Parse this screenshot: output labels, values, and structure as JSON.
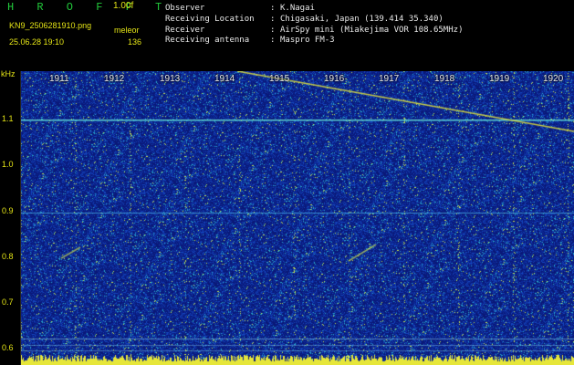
{
  "header": {
    "app_title": "H R O F F T",
    "version": "1.00f",
    "filename": "KN9_2506281910.png",
    "mode": "meleor",
    "datetime": "25.06.28 19:10",
    "count": "136"
  },
  "info": [
    {
      "key": "Observer",
      "value": "K.Nagai"
    },
    {
      "key": "Receiving Location",
      "value": "Chigasaki, Japan (139.414 35.340)"
    },
    {
      "key": "Receiver",
      "value": "AirSpy mini (Miakejima VOR 108.65MHz)"
    },
    {
      "key": "Receiving antenna",
      "value": "Maspro FM-3"
    }
  ],
  "separator": ":",
  "y_axis": {
    "unit": "kHz",
    "ticks": [
      "1.1",
      "1.0",
      "0.9",
      "0.8",
      "0.7",
      "0.6"
    ]
  },
  "x_axis": {
    "ticks": [
      "1911",
      "1912",
      "1913",
      "1914",
      "1915",
      "1916",
      "1917",
      "1918",
      "1919",
      "1920"
    ]
  },
  "colors": {
    "background": "#000000",
    "spectrum_base": "#0a1c8c",
    "carrier": "#3fd8d0",
    "signal": "#e6e63a",
    "title": "#22c93b",
    "labels": "#e4e416"
  }
}
